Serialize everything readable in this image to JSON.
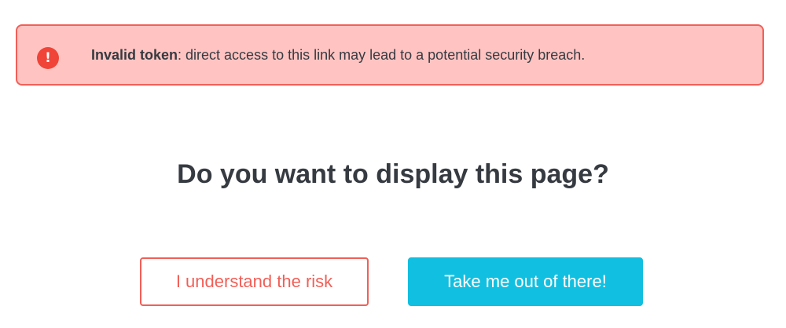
{
  "alert": {
    "icon": "exclamation-circle-icon",
    "icon_glyph": "!",
    "title": "Invalid token",
    "message": ": direct access to this link may lead to a potential security breach.",
    "background_color": "#ffc4c2",
    "border_color": "#f15f57",
    "icon_color": "#f04438"
  },
  "question": "Do you want to display this page?",
  "actions": {
    "risk_label": "I understand the risk",
    "leave_label": "Take me out of there!",
    "risk_color": "#f15f57",
    "leave_color": "#11bfe0"
  }
}
